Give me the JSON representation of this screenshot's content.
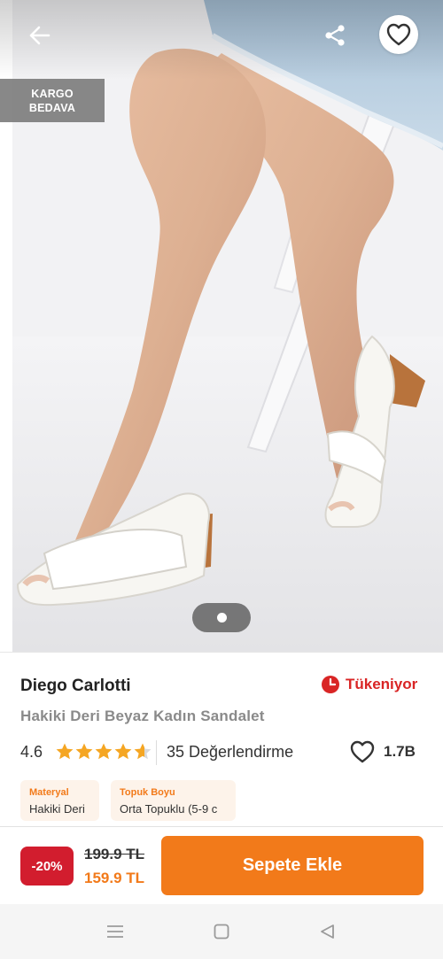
{
  "hero": {
    "badge_line1": "KARGO",
    "badge_line2": "BEDAVA",
    "icons": {
      "back": "arrow-left-icon",
      "share": "share-icon",
      "favorite": "heart-outline-icon"
    },
    "gallery_page": 1
  },
  "product": {
    "brand": "Diego Carlotti",
    "stock_status": "Tükeniyor",
    "name": "Hakiki Deri Beyaz Kadın Sandalet",
    "rating": "4.6",
    "rating_value": 4.6,
    "reviews": "35 Değerlendirme",
    "favorites": "1.7B"
  },
  "attributes": [
    {
      "title": "Materyal",
      "value": "Hakiki Deri"
    },
    {
      "title": "Topuk Boyu",
      "value": "Orta Topuklu (5-9 c"
    }
  ],
  "purchase": {
    "discount": "-20%",
    "old_price": "199.9 TL",
    "new_price": "159.9 TL",
    "cta": "Sepete Ekle"
  },
  "colors": {
    "accent": "#f27a1a",
    "discount": "#d21d2e",
    "stock": "#d92525",
    "star": "#f5a623"
  }
}
